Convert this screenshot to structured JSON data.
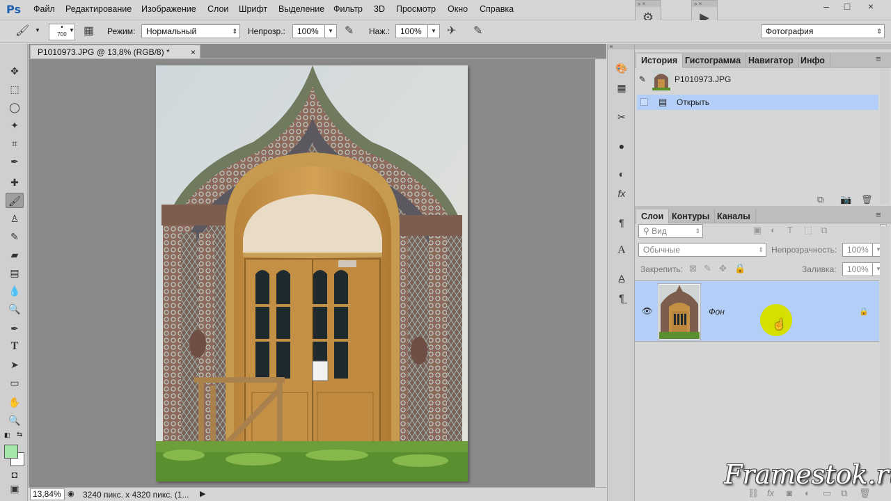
{
  "app": {
    "logo": "Ps"
  },
  "menu": [
    "Файл",
    "Редактирование",
    "Изображение",
    "Слои",
    "Шрифт",
    "Выделение",
    "Фильтр",
    "3D",
    "Просмотр",
    "Окно",
    "Справка"
  ],
  "workspace": "Фотография",
  "options": {
    "brush_size": "700",
    "mode_label": "Режим:",
    "mode_value": "Нормальный",
    "opacity_label": "Непрозр.:",
    "opacity_value": "100%",
    "pressure_label": "Наж.:",
    "pressure_value": "100%"
  },
  "document": {
    "tab_title": "P1010973.JPG @ 13,8% (RGB/8) *",
    "close": "×",
    "zoom": "13,84%",
    "status": "3240 пикс. x 4320 пикс. (1..."
  },
  "history_panel": {
    "tabs": [
      "История",
      "Гистограмма",
      "Навигатор",
      "Инфо"
    ],
    "snapshot": "P1010973.JPG",
    "steps": [
      "Открыть"
    ]
  },
  "layers_panel": {
    "tabs": [
      "Слои",
      "Контуры",
      "Каналы"
    ],
    "filter_placeholder": "Вид",
    "blend": "Обычные",
    "opacity_label": "Непрозрачность:",
    "opacity_value": "100%",
    "lock_label": "Закрепить:",
    "fill_label": "Заливка:",
    "fill_value": "100%",
    "layers": [
      {
        "name": "Фон"
      }
    ]
  },
  "watermark": "Framestok.ru",
  "colors": {
    "foreground": "#a4e7a8",
    "background": "#ffffff",
    "selection": "#b4cff7",
    "cursor_highlight": "#d6e000"
  }
}
